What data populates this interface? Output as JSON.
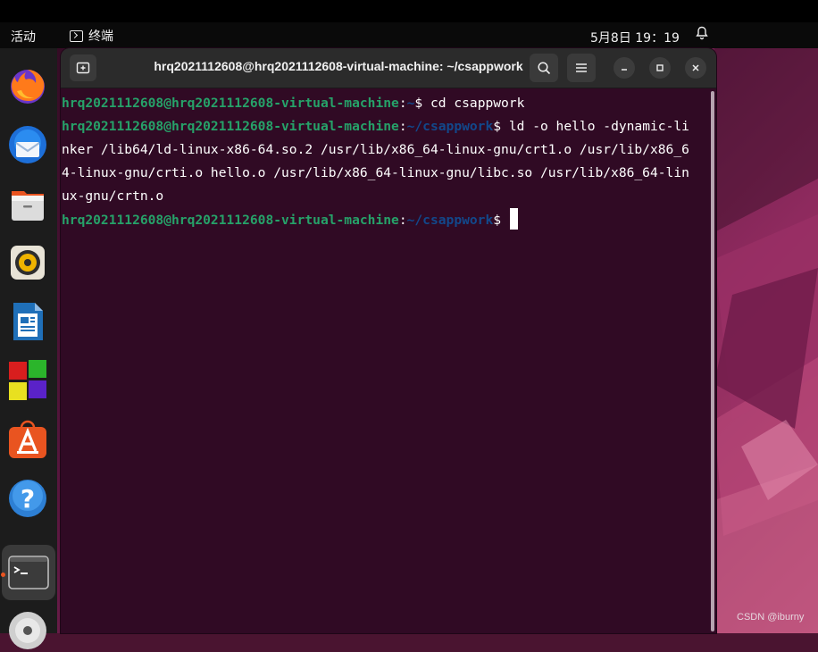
{
  "topbar": {
    "activities": "活动",
    "app_name": "终端",
    "clock": "5月8日  19：19"
  },
  "dock": {
    "items": [
      {
        "icon": "firefox-icon"
      },
      {
        "icon": "thunderbird-icon"
      },
      {
        "icon": "files-icon"
      },
      {
        "icon": "rhythmbox-icon"
      },
      {
        "icon": "libreoffice-writer-icon"
      },
      {
        "icon": "software-boxes-icon"
      },
      {
        "icon": "ubuntu-software-icon"
      },
      {
        "icon": "help-icon"
      },
      {
        "icon": "terminal-icon",
        "active": true
      },
      {
        "icon": "dvd-icon"
      }
    ]
  },
  "terminal": {
    "title": "hrq2021112608@hrq2021112608-virtual-machine: ~/csappwork",
    "prompt_user": "hrq2021112608@hrq2021112608-virtual-machine",
    "sep": ":",
    "path_home": "~",
    "path_work": "~/csappwork",
    "dollar": "$ ",
    "cmd1": "cd csappwork",
    "cmd2_first": "ld -o hello -dynamic-li",
    "cmd2_lines": [
      "nker /lib64/ld-linux-x86-64.so.2 /usr/lib/x86_64-linux-gnu/crt1.o /usr/lib/x86_6",
      "4-linux-gnu/crti.o hello.o /usr/lib/x86_64-linux-gnu/libc.so /usr/lib/x86_64-lin",
      "ux-gnu/crtn.o"
    ]
  },
  "colors": {
    "terminal_bg": "#300a24",
    "prompt_green": "#26a269",
    "path_blue": "#12488b",
    "accent_orange": "#e95420"
  },
  "watermark": "CSDN @iburny"
}
